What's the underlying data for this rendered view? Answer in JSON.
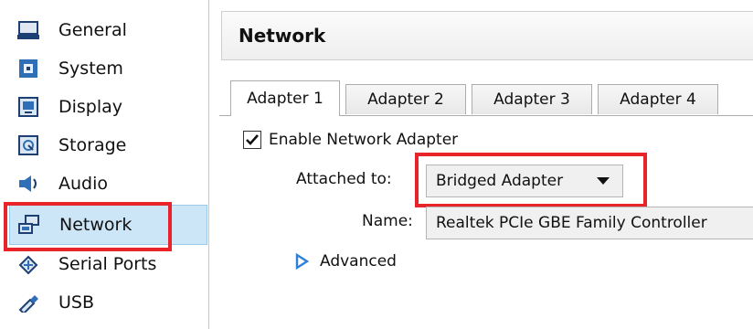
{
  "sidebar": {
    "items": [
      {
        "label": "General",
        "icon": "monitor-icon"
      },
      {
        "label": "System",
        "icon": "chip-icon"
      },
      {
        "label": "Display",
        "icon": "display-icon"
      },
      {
        "label": "Storage",
        "icon": "storage-icon"
      },
      {
        "label": "Audio",
        "icon": "speaker-icon"
      },
      {
        "label": "Network",
        "icon": "network-icon"
      },
      {
        "label": "Serial Ports",
        "icon": "serial-port-icon"
      },
      {
        "label": "USB",
        "icon": "usb-icon"
      }
    ],
    "selected": "Network"
  },
  "header": {
    "title": "Network"
  },
  "tabs": [
    {
      "label": "Adapter 1",
      "active": true
    },
    {
      "label": "Adapter 2",
      "active": false
    },
    {
      "label": "Adapter 3",
      "active": false
    },
    {
      "label": "Adapter 4",
      "active": false
    }
  ],
  "adapter": {
    "enable_label": "Enable Network Adapter",
    "enabled": true,
    "attached_label": "Attached to:",
    "attached_value": "Bridged Adapter",
    "name_label": "Name:",
    "name_value": "Realtek PCIe GBE Family Controller",
    "advanced_label": "Advanced"
  },
  "colors": {
    "highlight": "#e8232a",
    "selection": "#cde6f7",
    "icon_blue": "#2f6fb7"
  }
}
